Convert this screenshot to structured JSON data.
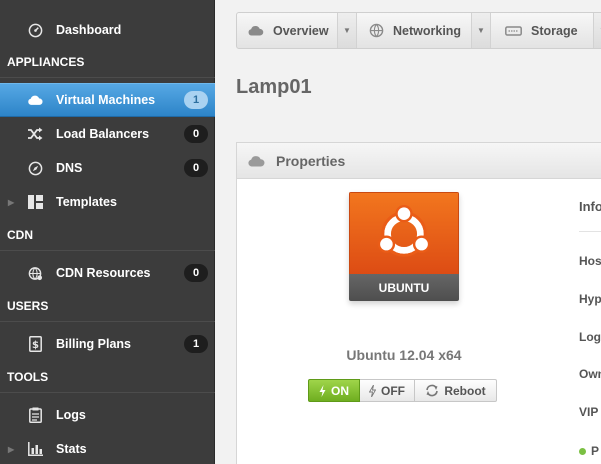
{
  "sidebar": {
    "dashboard": {
      "label": "Dashboard",
      "icon": "speedometer-icon"
    },
    "sections": [
      {
        "title": "APPLIANCES"
      },
      {
        "title": "CDN"
      },
      {
        "title": "USERS"
      },
      {
        "title": "TOOLS"
      }
    ],
    "items": [
      {
        "label": "Virtual Machines",
        "badge": "1",
        "icon": "cloud-icon",
        "active": true
      },
      {
        "label": "Load Balancers",
        "badge": "0",
        "icon": "shuffle-icon"
      },
      {
        "label": "DNS",
        "badge": "0",
        "icon": "compass-icon"
      },
      {
        "label": "Templates",
        "icon": "layout-icon"
      },
      {
        "label": "CDN Resources",
        "badge": "0",
        "icon": "globe-icon"
      },
      {
        "label": "Billing Plans",
        "badge": "1",
        "icon": "dollar-document-icon"
      },
      {
        "label": "Logs",
        "icon": "clipboard-icon"
      },
      {
        "label": "Stats",
        "icon": "bar-chart-icon"
      }
    ]
  },
  "tabs": [
    {
      "label": "Overview",
      "icon": "cloud-icon"
    },
    {
      "label": "Networking",
      "icon": "globe-icon"
    },
    {
      "label": "Storage",
      "icon": "disk-icon"
    }
  ],
  "page": {
    "title": "Lamp01"
  },
  "properties": {
    "title": "Properties",
    "os_tile_label": "UBUNTU",
    "os_name": "Ubuntu 12.04 x64",
    "power": {
      "on": "ON",
      "off": "OFF",
      "reboot": "Reboot"
    },
    "info_title": "Info",
    "info_rows": [
      "Hos",
      "Hyp",
      "Log",
      "Own",
      "VIP",
      "P"
    ]
  },
  "colors": {
    "active_blue": "#2d84c8",
    "ubuntu_orange": "#dd4c14",
    "on_green": "#6fae20",
    "status_green": "#7bc043"
  }
}
